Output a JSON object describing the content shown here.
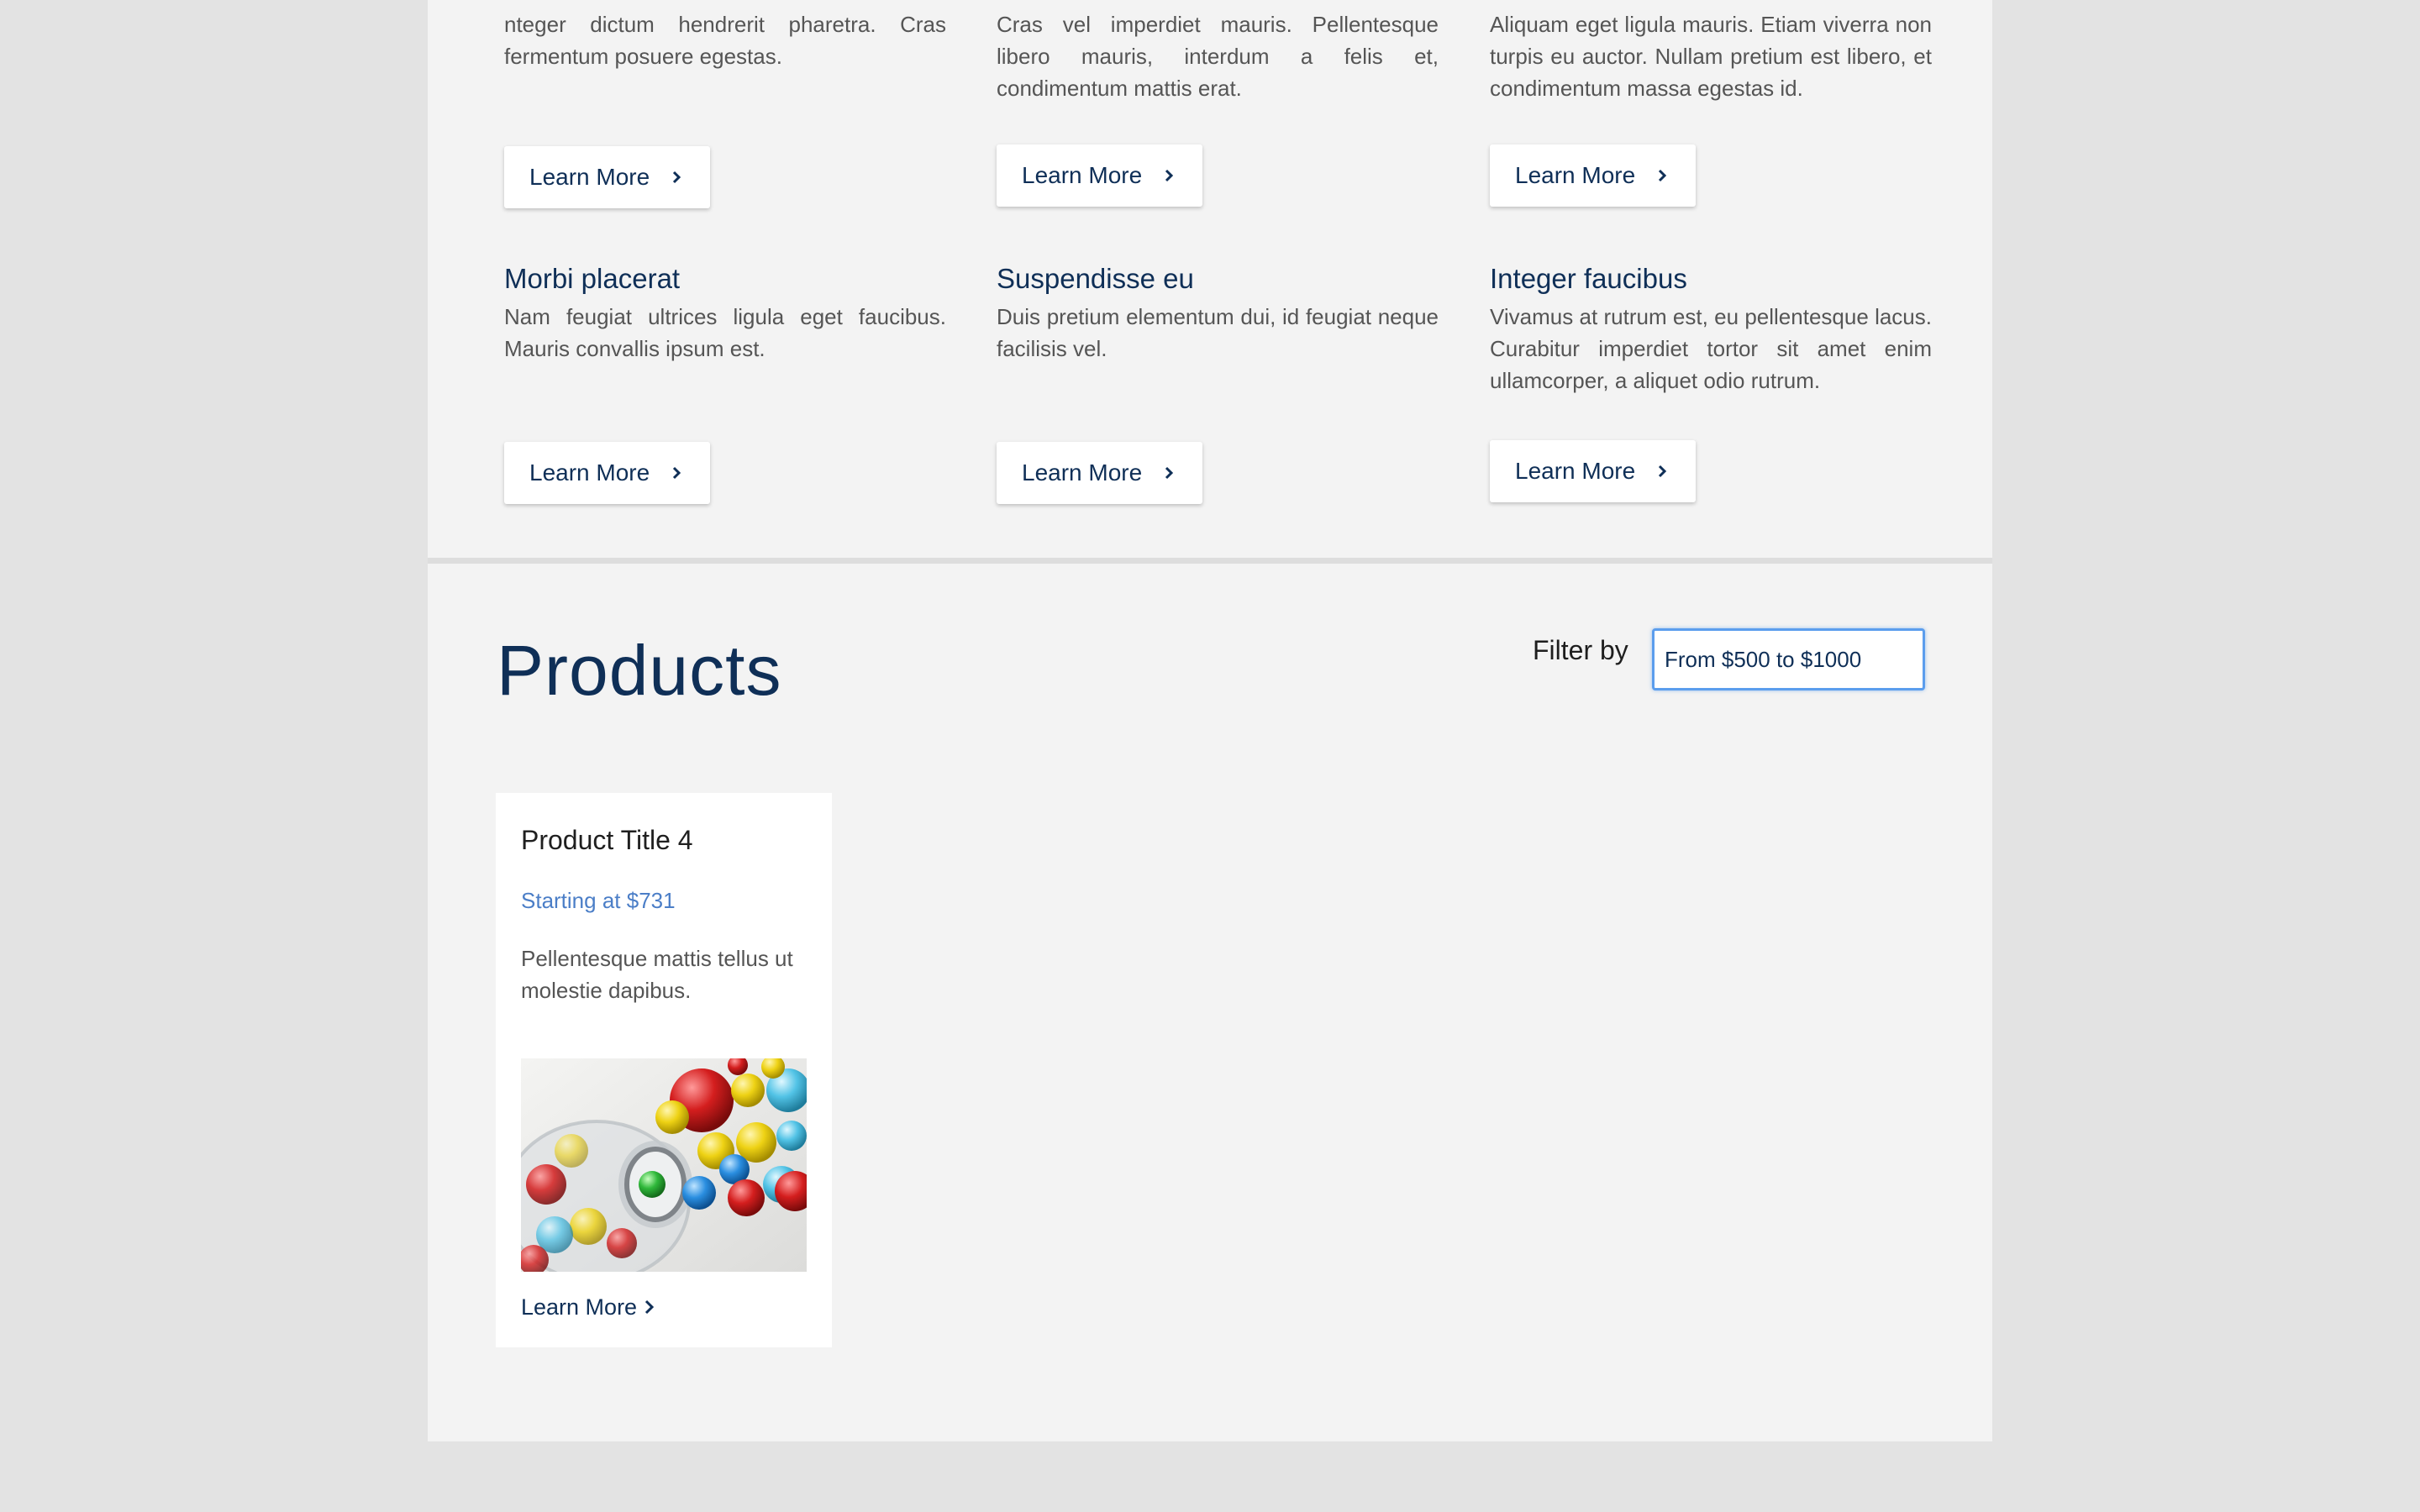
{
  "features": [
    {
      "title": "",
      "text": "nteger dictum hendrerit pharetra. Cras fermentum posuere egestas.",
      "button": "Learn More"
    },
    {
      "title": "",
      "text": "Cras vel imperdiet mauris. Pellentesque libero mauris, interdum a felis et, condimentum mattis erat.",
      "button": "Learn More"
    },
    {
      "title": "",
      "text": "Aliquam eget ligula mauris. Etiam viverra non turpis eu auctor. Nullam pretium est libero, et condimentum massa egestas id.",
      "button": "Learn More"
    },
    {
      "title": "Morbi placerat",
      "text": "Nam feugiat ultrices ligula eget faucibus. Mauris convallis ipsum est.",
      "button": "Learn More"
    },
    {
      "title": "Suspendisse eu",
      "text": "Duis pretium elementum dui, id feugiat neque facilisis vel.",
      "button": "Learn More"
    },
    {
      "title": "Integer faucibus",
      "text": "Vivamus at rutrum est, eu pellentesque lacus. Curabitur imperdiet tortor sit amet enim ullamcorper, a aliquet odio rutrum.",
      "button": "Learn More"
    }
  ],
  "products": {
    "heading": "Products",
    "filter_label": "Filter by",
    "filter_value": "From $500 to $1000",
    "cards": [
      {
        "title": "Product Title 4",
        "price": "Starting at $731",
        "description": "Pellentesque mattis tellus ut molestie dapibus.",
        "image_icon": "marbles-jar-photo",
        "link": "Learn More"
      }
    ]
  },
  "colors": {
    "heading": "#0f2f57",
    "price": "#4b7ec7",
    "focus_ring": "#5b9ded",
    "page_bg": "#e3e3e3",
    "panel_bg": "#f3f3f3"
  }
}
